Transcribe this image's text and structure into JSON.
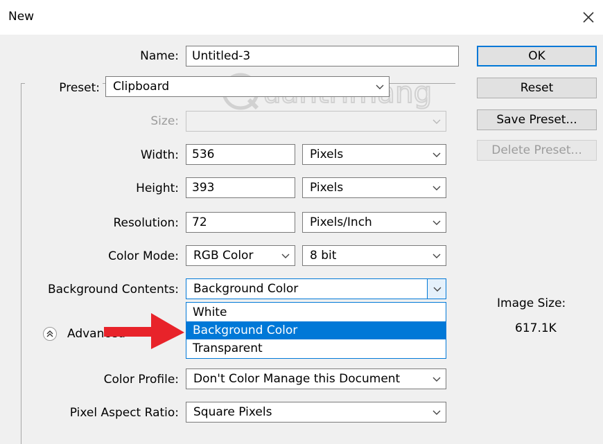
{
  "window": {
    "title": "New"
  },
  "form": {
    "name": {
      "label": "Name:",
      "value": "Untitled-3"
    },
    "preset": {
      "label": "Preset:",
      "value": "Clipboard"
    },
    "size": {
      "label": "Size:",
      "value": ""
    },
    "width": {
      "label": "Width:",
      "value": "536",
      "unit": "Pixels"
    },
    "height": {
      "label": "Height:",
      "value": "393",
      "unit": "Pixels"
    },
    "resolution": {
      "label": "Resolution:",
      "value": "72",
      "unit": "Pixels/Inch"
    },
    "color_mode": {
      "label": "Color Mode:",
      "value": "RGB Color",
      "depth": "8 bit"
    },
    "background": {
      "label": "Background Contents:",
      "value": "Background Color",
      "options": [
        "White",
        "Background Color",
        "Transparent"
      ]
    },
    "advanced": {
      "label": "Advanced"
    },
    "color_profile": {
      "label": "Color Profile:",
      "value": "Don't Color Manage this Document"
    },
    "pixel_aspect": {
      "label": "Pixel Aspect Ratio:",
      "value": "Square Pixels"
    }
  },
  "buttons": {
    "ok": "OK",
    "reset": "Reset",
    "save_preset": "Save Preset...",
    "delete_preset": "Delete Preset..."
  },
  "info": {
    "image_size_label": "Image Size:",
    "image_size_value": "617.1K"
  },
  "watermark": {
    "text": "uantrimang"
  },
  "colors": {
    "accent": "#0078d7",
    "arrow": "#e8232a",
    "dialog_bg": "#f0f0f0"
  }
}
